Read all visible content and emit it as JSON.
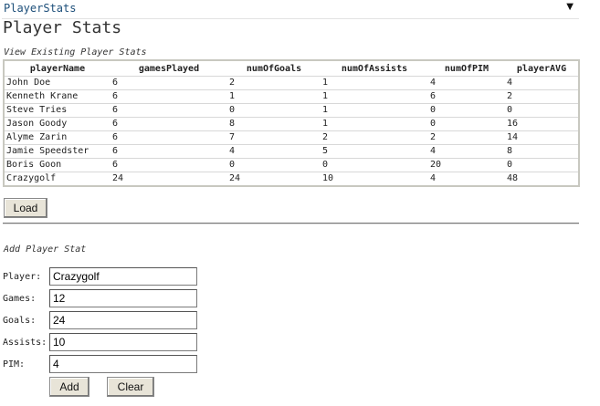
{
  "window": {
    "title": "PlayerStats"
  },
  "page": {
    "heading": "Player Stats"
  },
  "view_section": {
    "label": "View Existing Player Stats"
  },
  "table": {
    "columns": [
      "playerName",
      "gamesPlayed",
      "numOfGoals",
      "numOfAssists",
      "numOfPIM",
      "playerAVG"
    ],
    "rows": [
      [
        "John Doe",
        "6",
        "2",
        "1",
        "4",
        "4"
      ],
      [
        "Kenneth Krane",
        "6",
        "1",
        "1",
        "6",
        "2"
      ],
      [
        "Steve Tries",
        "6",
        "0",
        "1",
        "0",
        "0"
      ],
      [
        "Jason Goody",
        "6",
        "8",
        "1",
        "0",
        "16"
      ],
      [
        "Alyme Zarin",
        "6",
        "7",
        "2",
        "2",
        "14"
      ],
      [
        "Jamie Speedster",
        "6",
        "4",
        "5",
        "4",
        "8"
      ],
      [
        "Boris Goon",
        "6",
        "0",
        "0",
        "20",
        "0"
      ],
      [
        "Crazygolf",
        "24",
        "24",
        "10",
        "4",
        "48"
      ]
    ]
  },
  "buttons": {
    "load": "Load",
    "add": "Add",
    "clear": "Clear"
  },
  "add_section": {
    "label": "Add Player Stat"
  },
  "form": {
    "player": {
      "label": "Player:",
      "value": "Crazygolf"
    },
    "games": {
      "label": "Games:",
      "value": "12"
    },
    "goals": {
      "label": "Goals:",
      "value": "24"
    },
    "assists": {
      "label": "Assists:",
      "value": "10"
    },
    "pim": {
      "label": "PIM:",
      "value": "4"
    }
  },
  "colors": {
    "title_text": "#1d4f7a",
    "button_face": "#e8e4d8"
  }
}
